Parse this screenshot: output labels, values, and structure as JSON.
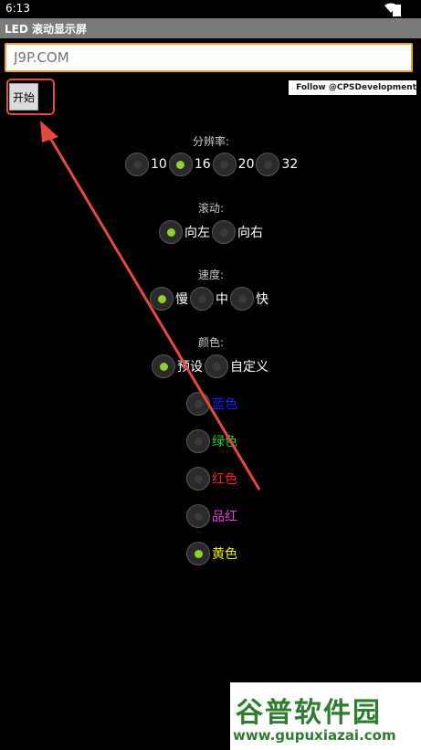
{
  "status": {
    "time": "6:13"
  },
  "app": {
    "title": "LED 滚动显示屏"
  },
  "input": {
    "value": "",
    "placeholder": "J9P.COM"
  },
  "start_button": {
    "label": "开始"
  },
  "follow_badge": {
    "text": "Follow @CPSDevelopment"
  },
  "resolution": {
    "label": "分辨率:",
    "options": [
      "10",
      "16",
      "20",
      "32"
    ],
    "selected": "16"
  },
  "scroll": {
    "label": "滚动:",
    "options": [
      "向左",
      "向右"
    ],
    "selected": "向左"
  },
  "speed": {
    "label": "速度:",
    "options": [
      "慢",
      "中",
      "快"
    ],
    "selected": "慢"
  },
  "color": {
    "label": "颜色:",
    "options": [
      "预设",
      "自定义"
    ],
    "selected": "预设",
    "presets": [
      {
        "label": "蓝色",
        "color": "#1d1dff"
      },
      {
        "label": "绿色",
        "color": "#1ed11e"
      },
      {
        "label": "红色",
        "color": "#ff1a1a"
      },
      {
        "label": "品红",
        "color": "#e23ee2"
      },
      {
        "label": "黄色",
        "color": "#f3f31f"
      }
    ],
    "preset_selected": "黄色"
  },
  "watermark": {
    "line1": "谷普软件园",
    "line2": "www.gupuxiazai.com"
  },
  "colors": {
    "accent_border": "#f0a13a",
    "annotation_red": "#e34a3a",
    "radio_on": "#8fd12e"
  }
}
